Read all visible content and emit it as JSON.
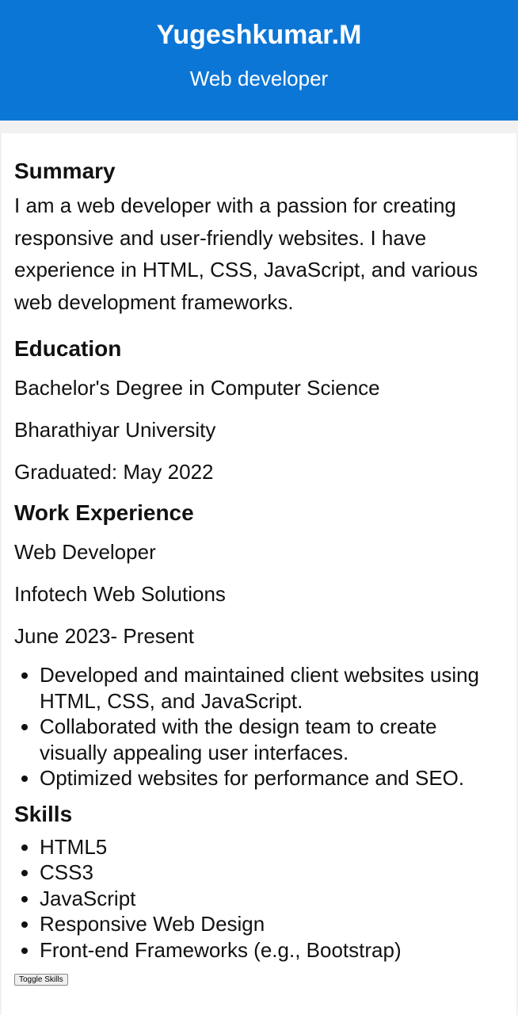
{
  "header": {
    "name": "Yugeshkumar.M",
    "role": "Web developer"
  },
  "summary": {
    "title": "Summary",
    "text": "I am a web developer with a passion for creating responsive and user-friendly websites. I have experience in HTML, CSS, JavaScript, and various web development frameworks."
  },
  "education": {
    "title": "Education",
    "degree": "Bachelor's Degree in Computer Science",
    "university": "Bharathiyar University",
    "graduated": "Graduated: May 2022"
  },
  "work": {
    "title": "Work Experience",
    "position": "Web Developer",
    "company": "Infotech Web Solutions",
    "period": "June 2023- Present",
    "duties": [
      "Developed and maintained client websites using HTML, CSS, and JavaScript.",
      "Collaborated with the design team to create visually appealing user interfaces.",
      "Optimized websites for performance and SEO."
    ]
  },
  "skills": {
    "title": "Skills",
    "items": [
      "HTML5",
      "CSS3",
      "JavaScript",
      "Responsive Web Design",
      "Front-end Frameworks (e.g., Bootstrap)"
    ],
    "toggle_label": "Toggle Skills"
  },
  "colors": {
    "header_bg": "#0c76d6",
    "header_text": "#ffffff",
    "page_bg": "#f1f1f1",
    "card_bg": "#ffffff"
  }
}
